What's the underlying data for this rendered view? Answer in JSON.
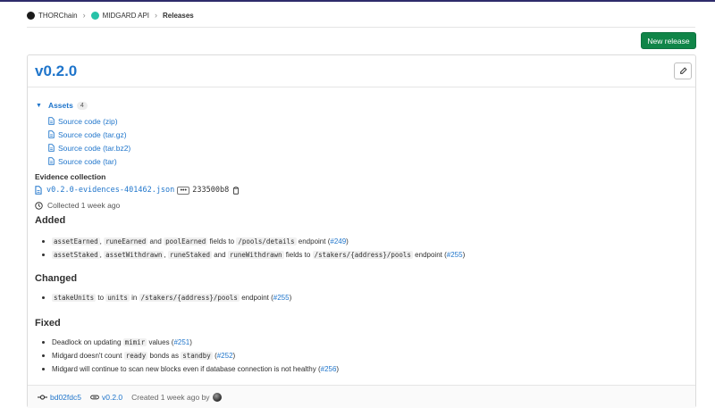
{
  "breadcrumb": {
    "org": "THORChain",
    "project": "MIDGARD API",
    "current": "Releases"
  },
  "actions": {
    "new_release": "New release"
  },
  "release": {
    "title": "v0.2.0",
    "assets": {
      "label": "Assets",
      "count": "4",
      "items": [
        "Source code (zip)",
        "Source code (tar.gz)",
        "Source code (tar.bz2)",
        "Source code (tar)"
      ]
    },
    "evidence": {
      "title": "Evidence collection",
      "file": "v0.2.0-evidences-401462.json",
      "sha": "233500b8",
      "collected": "Collected 1 week ago"
    },
    "sections": {
      "added": {
        "heading": "Added",
        "line1": {
          "c1": "assetEarned",
          "t1": ",",
          "c2": "runeEarned",
          "t2": "and",
          "c3": "poolEarned",
          "t3": "fields to",
          "c4": "/pools/details",
          "t4": "endpoint (",
          "link": "#249",
          "t5": ")"
        },
        "line2": {
          "c1": "assetStaked",
          "t1": ",",
          "c2": "assetWithdrawn",
          "t2": ",",
          "c3": "runeStaked",
          "t3": "and",
          "c4": "runeWithdrawn",
          "t4": "fields to",
          "c5": "/stakers/{address}/pools",
          "t5": "endpoint (",
          "link": "#255",
          "t6": ")"
        }
      },
      "changed": {
        "heading": "Changed",
        "line1": {
          "c1": "stakeUnits",
          "t1": "to",
          "c2": "units",
          "t2": "in",
          "c3": "/stakers/{address}/pools",
          "t3": "endpoint (",
          "link": "#255",
          "t4": ")"
        }
      },
      "fixed": {
        "heading": "Fixed",
        "line1": {
          "t1": "Deadlock on updating",
          "c1": "mimir",
          "t2": "values (",
          "link": "#251",
          "t3": ")"
        },
        "line2": {
          "t1": "Midgard doesn't count",
          "c1": "ready",
          "t2": "bonds as",
          "c2": "standby",
          "t3": "(",
          "link": "#252",
          "t4": ")"
        },
        "line3": {
          "t1": "Midgard will continue to scan new blocks even if database connection is not healthy (",
          "link": "#256",
          "t2": ")"
        }
      }
    },
    "footer": {
      "commit": "bd02fdc5",
      "tag": "v0.2.0",
      "created": "Created 1 week ago by"
    }
  },
  "colors": {
    "link": "#1f75cb",
    "primary_button": "#108548",
    "top_bar": "#2e2b6b"
  },
  "icons": [
    "chevron-down-icon",
    "file-icon",
    "clipboard-icon",
    "clock-icon",
    "pencil-icon",
    "commit-icon",
    "tag-icon"
  ]
}
